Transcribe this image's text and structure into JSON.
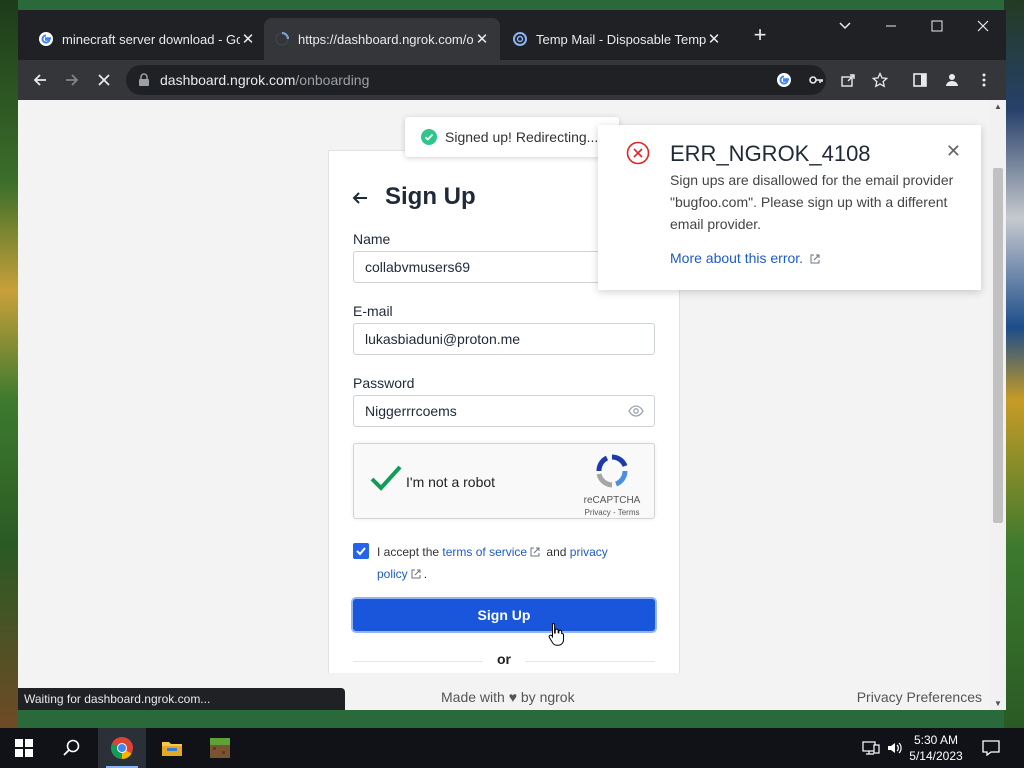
{
  "browser": {
    "tabs": [
      {
        "title": "minecraft server download - Goo",
        "favicon": "google-icon",
        "active": false
      },
      {
        "title": "https://dashboard.ngrok.com/on",
        "favicon": "loading-spinner-icon",
        "active": true
      },
      {
        "title": "Temp Mail - Disposable Tempora",
        "favicon": "tempmail-icon",
        "active": false
      }
    ],
    "url_host": "dashboard.ngrok.com",
    "url_path": "/onboarding",
    "status_text": "Waiting for dashboard.ngrok.com..."
  },
  "toast": {
    "text": "Signed up! Redirecting..."
  },
  "error": {
    "code": "ERR_NGROK_4108",
    "message": "Sign ups are disallowed for the email provider \"bugfoo.com\". Please sign up with a different email provider.",
    "link": "More about this error."
  },
  "form": {
    "title": "Sign Up",
    "name_label": "Name",
    "name_value": "collabvmusers69",
    "email_label": "E-mail",
    "email_value": "lukasbiaduni@proton.me",
    "password_label": "Password",
    "password_value": "Niggerrrcoems",
    "captcha_text": "I'm not a robot",
    "captcha_brand": "reCAPTCHA",
    "captcha_links": "Privacy - Terms",
    "terms_prefix": "I accept the",
    "terms_link": "terms of service",
    "terms_and": "and",
    "privacy_link": "privacy",
    "privacy_link2": "policy",
    "terms_end": ".",
    "submit_label": "Sign Up",
    "or_text": "or"
  },
  "footer": {
    "made_with": "Made with ♥ by ngrok",
    "privacy": "Privacy Preferences"
  },
  "taskbar": {
    "time": "5:30 AM",
    "date": "5/14/2023"
  },
  "colors": {
    "accent": "#1a56db",
    "error": "#e02424",
    "success": "#31c48d",
    "chrome_dark": "#202124"
  }
}
